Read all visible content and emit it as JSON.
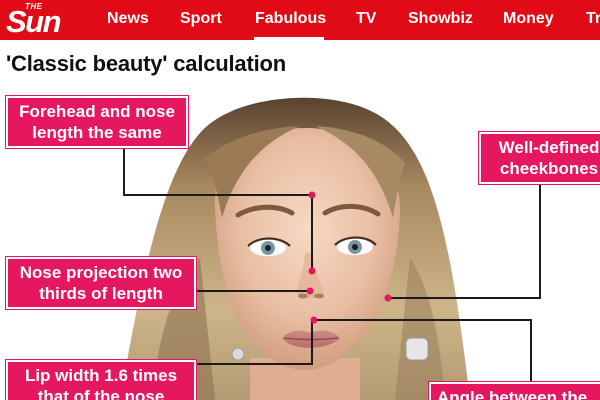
{
  "brand": {
    "logo_small": "THE",
    "logo_word": "Sun",
    "color": "#e00b16"
  },
  "nav": {
    "items": [
      {
        "label": "News"
      },
      {
        "label": "Sport"
      },
      {
        "label": "Fabulous",
        "active": true
      },
      {
        "label": "TV"
      },
      {
        "label": "Showbiz"
      },
      {
        "label": "Money"
      },
      {
        "label": "Tr"
      }
    ]
  },
  "headline": "'Classic beauty' calculation",
  "graphic": {
    "accent": "#e5175f",
    "callouts": [
      {
        "line1": "Forehead and nose",
        "line2": "length the same"
      },
      {
        "line1": "Well-defined",
        "line2": "cheekbones"
      },
      {
        "line1": "Nose projection two",
        "line2": "thirds of length"
      },
      {
        "line1": "Lip width 1.6 times",
        "line2": "that of the nose"
      },
      {
        "line1": "Angle between the"
      }
    ]
  }
}
